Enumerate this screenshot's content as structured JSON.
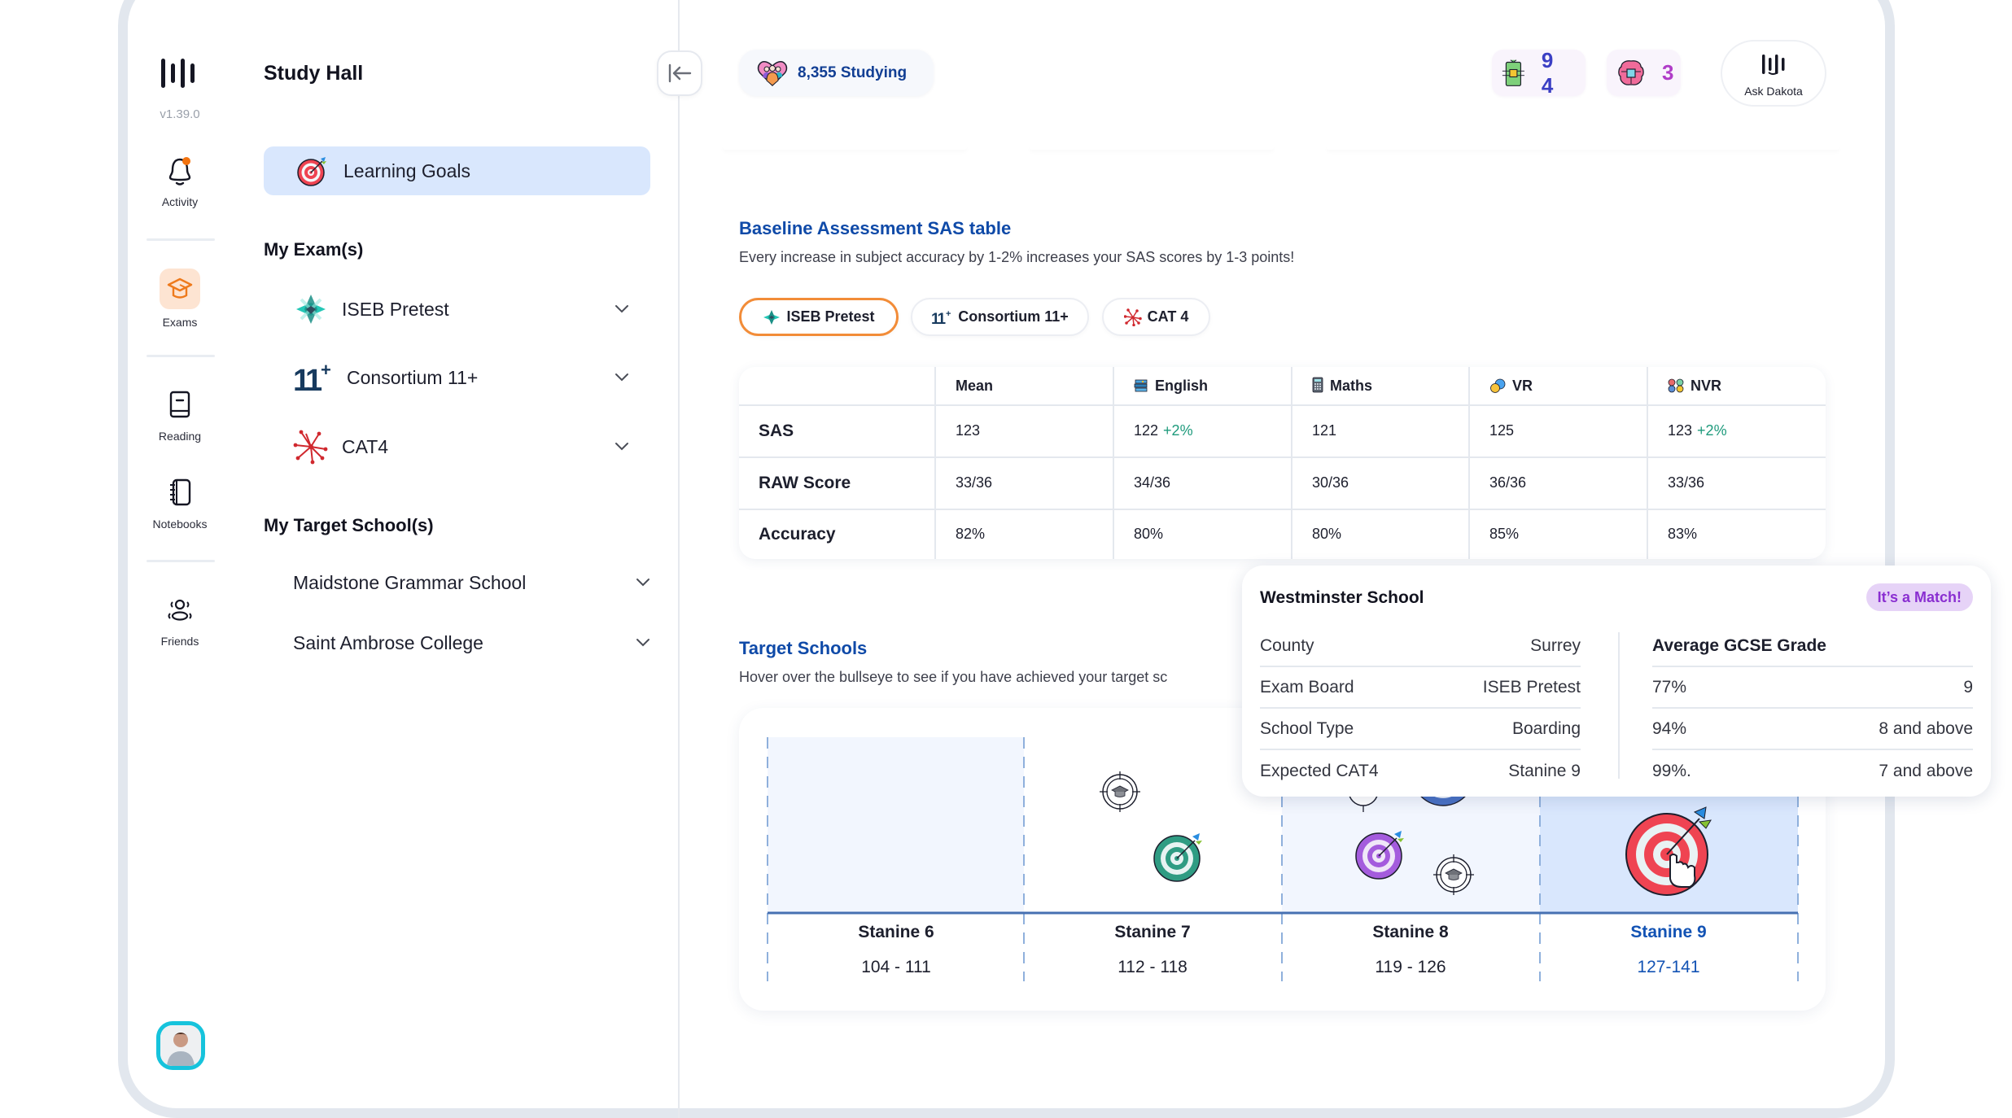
{
  "app": {
    "version": "v1.39.0",
    "section_title": "Study Hall"
  },
  "rail": {
    "items": [
      {
        "label": "Activity",
        "icon": "bell-icon",
        "notification": true
      },
      {
        "label": "Exams",
        "icon": "graduation-cap-icon",
        "active": true
      },
      {
        "label": "Reading",
        "icon": "book-icon"
      },
      {
        "label": "Notebooks",
        "icon": "notebook-icon"
      },
      {
        "label": "Friends",
        "icon": "friends-icon"
      }
    ],
    "avatar": "user-avatar"
  },
  "sidebar": {
    "learning_goals": "Learning Goals",
    "exams_title": "My Exam(s)",
    "exams": [
      {
        "label": "ISEB Pretest",
        "icon": "iseb-logo-icon"
      },
      {
        "label": "Consortium 11+",
        "icon": "eleven-plus-logo-icon"
      },
      {
        "label": "CAT4",
        "icon": "cat4-logo-icon"
      }
    ],
    "schools_title": "My Target School(s)",
    "schools": [
      {
        "label": "Maidstone Grammar School"
      },
      {
        "label": "Saint Ambrose College"
      }
    ]
  },
  "topbar": {
    "studying": "8,355 Studying",
    "badge_chip": {
      "value": "9 4",
      "icon": "chip-icon",
      "color": "#3b3fc4"
    },
    "badge_brain": {
      "value": "3",
      "icon": "brain-icon",
      "color": "#b03cc8"
    },
    "ask_label": "Ask Dakota"
  },
  "baseline": {
    "title": "Baseline Assessment SAS table",
    "subtitle": "Every increase in subject accuracy by 1-2% increases your SAS scores by 1-3 points!",
    "tabs": [
      {
        "label": "ISEB Pretest",
        "active": true
      },
      {
        "label": "Consortium 11+",
        "active": false
      },
      {
        "label": "CAT 4",
        "active": false
      }
    ],
    "table": {
      "columns": [
        "",
        "Mean",
        "English",
        "Maths",
        "VR",
        "NVR"
      ],
      "rows": [
        {
          "label": "SAS",
          "cells": [
            {
              "value": "123",
              "delta": ""
            },
            {
              "value": "122",
              "delta": "+2%"
            },
            {
              "value": "121",
              "delta": ""
            },
            {
              "value": "125",
              "delta": ""
            },
            {
              "value": "123",
              "delta": "+2%"
            }
          ]
        },
        {
          "label": "RAW Score",
          "cells": [
            {
              "value": "33/36",
              "delta": ""
            },
            {
              "value": "34/36",
              "delta": ""
            },
            {
              "value": "30/36",
              "delta": ""
            },
            {
              "value": "36/36",
              "delta": ""
            },
            {
              "value": "33/36",
              "delta": ""
            }
          ]
        },
        {
          "label": "Accuracy",
          "cells": [
            {
              "value": "82%",
              "delta": ""
            },
            {
              "value": "80%",
              "delta": ""
            },
            {
              "value": "80%",
              "delta": ""
            },
            {
              "value": "85%",
              "delta": ""
            },
            {
              "value": "83%",
              "delta": ""
            }
          ]
        }
      ]
    }
  },
  "targets": {
    "title": "Target Schools",
    "subtitle": "Hover over the bullseye to see if you have achieved your target sc",
    "stanines": [
      {
        "label": "Stanine 6",
        "range": "104 - 111",
        "highlight": false
      },
      {
        "label": "Stanine 7",
        "range": "112 - 118",
        "highlight": false
      },
      {
        "label": "Stanine 8",
        "range": "119 - 126",
        "highlight": false
      },
      {
        "label": "Stanine 9",
        "range": "127-141",
        "highlight": true
      }
    ]
  },
  "popover": {
    "school": "Westminster School",
    "badge": "It’s a Match!",
    "details": [
      {
        "label": "County",
        "value": "Surrey"
      },
      {
        "label": "Exam Board",
        "value": "ISEB Pretest"
      },
      {
        "label": "School Type",
        "value": "Boarding"
      },
      {
        "label": "Expected CAT4",
        "value": "Stanine 9"
      }
    ],
    "gcse_title": "Average GCSE Grade",
    "gcse": [
      {
        "percent": "77%",
        "grade": "9"
      },
      {
        "percent": "94%",
        "grade": "8 and above"
      },
      {
        "percent": "99%.",
        "grade": "7 and above"
      }
    ]
  },
  "colors": {
    "accent_blue": "#0f4aa8",
    "active_tab": "#f28c38",
    "delta_green": "#1e9a7c",
    "match_purple": "#8a2fd1"
  }
}
